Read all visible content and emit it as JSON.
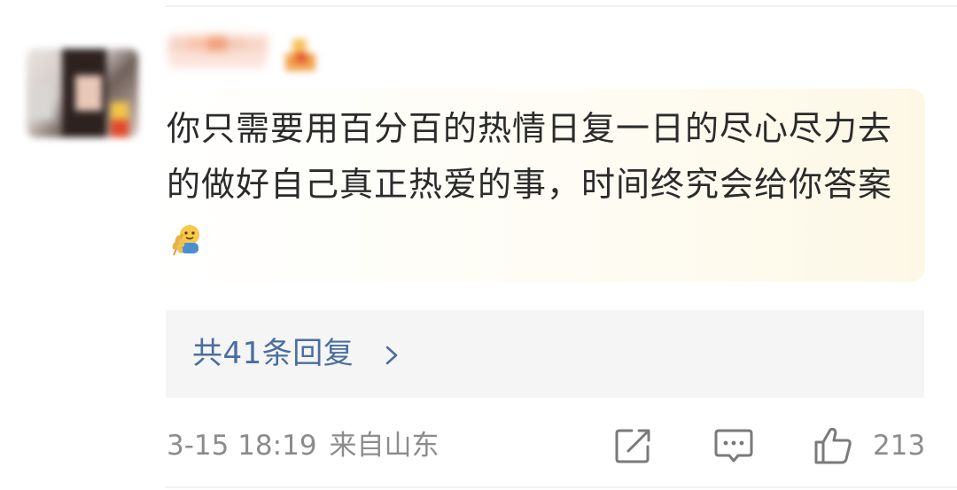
{
  "comment": {
    "username": "",
    "text": "你只需要用百分百的热情日复一日的尽心尽力去的做好自己真正热爱的事，时间终究会给你答案",
    "emoji_icon": "hugging-wheat-emoji-icon"
  },
  "replies": {
    "label": "共41条回复",
    "chevron_icon": "chevron-right-icon"
  },
  "footer": {
    "time": "3-15 18:19",
    "location": "来自山东",
    "like_count": "213",
    "icons": [
      "edit-icon",
      "comment-icon",
      "thumbs-up-icon"
    ]
  },
  "colors": {
    "reply_link": "#4a6ea0",
    "meta_text": "#8c8c8c",
    "comment_highlight": "#fdf8e6",
    "reply_bg": "#f5f5f5"
  }
}
